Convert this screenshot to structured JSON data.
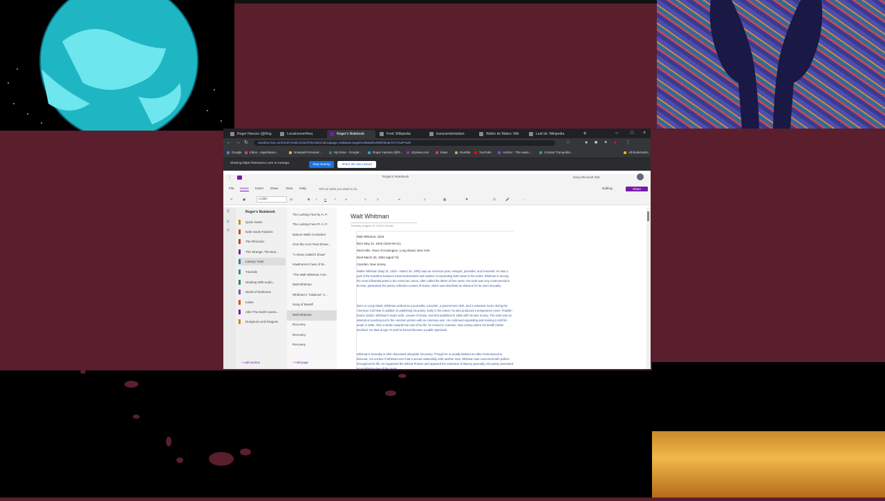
{
  "browser": {
    "tabs": [
      {
        "label": "Roger Hanson (@Rog"
      },
      {
        "label": "Localconvertfreq"
      },
      {
        "label": "Roger's Notebook"
      },
      {
        "label": "Fred: Wikipedia"
      },
      {
        "label": "transcendentalism"
      },
      {
        "label": "Walter de Mateo: Wik"
      },
      {
        "label": "Leaf de: Wikipedia"
      }
    ],
    "new_tab": "+",
    "url": "onedrive.live.com/redir?resid=DAE2F06A4E0C3E1&page=Edit&wd=target%28Walt%20Whitman%7C%2F%29",
    "bookmarks": [
      {
        "label": "Google",
        "color": "#4285f4"
      },
      {
        "label": "Inbox - rogerhanso...",
        "color": "#ea4335"
      },
      {
        "label": "Notepad Personal...",
        "color": "#f4b400"
      },
      {
        "label": "My Drive - Google...",
        "color": "#0f9d58"
      },
      {
        "label": "Roger Hanson (@R...",
        "color": "#1da1f2"
      },
      {
        "label": "cityview.com",
        "color": "#9c27b0"
      },
      {
        "label": "Kiwix",
        "color": "#e53935"
      },
      {
        "label": "Rumble",
        "color": "#85c742"
      },
      {
        "label": "YouTube",
        "color": "#ff0000"
      },
      {
        "label": "Anchor - The easie...",
        "color": "#8940fa"
      },
      {
        "label": "Contact Tranquilitо...",
        "color": "#34a853"
      },
      {
        "label": "All Bookmarks",
        "color": "#f4b400"
      }
    ],
    "share_notice": "Sharing https://streamco.com to meetgo.",
    "stop_sharing": "Stop sharing",
    "hide": "Share this tab instead"
  },
  "onenote": {
    "title": "Roger's Notebook",
    "user": "Easy Microsoft 365",
    "menu": [
      "File",
      "Home",
      "Insert",
      "Draw",
      "View",
      "Help"
    ],
    "selected_menu": "Home",
    "tell_me": "Tell me what you want to do",
    "editing": "Editing",
    "share": "Share",
    "font": "Calibri",
    "size": "11",
    "notebook": "Roger's Notebook",
    "sections": [
      {
        "label": "Quick Notes",
        "color": "#c28a1c"
      },
      {
        "label": "Dark Souls Fandom",
        "color": "#d04a0a"
      },
      {
        "label": "The Rhizomic",
        "color": "#c0392b"
      },
      {
        "label": "The Strange, The Bus...",
        "color": "#7719aa"
      },
      {
        "label": "Literary Voter",
        "color": "#2a7ab8"
      },
      {
        "label": "Tutorials",
        "color": "#16a085"
      },
      {
        "label": "Working With audio...",
        "color": "#2e8b3c"
      },
      {
        "label": "World of Darkness",
        "color": "#8e44ad"
      },
      {
        "label": "Kathe",
        "color": "#d35400"
      },
      {
        "label": "Alter The Earth Canne...",
        "color": "#7719aa"
      },
      {
        "label": "Dungeons and Dragons",
        "color": "#c28a1c"
      }
    ],
    "selected_section": "Literary Voter",
    "add_section": "+ Add section",
    "pages": [
      "The Lurking Fear by H. P.",
      "The Lurking Fear Pt. II, P.",
      "Nahum Wells Considers",
      "Give the Corn Past Showi...",
      "\"A Show Called's Show\"",
      "Hawthorne's hear of W...",
      "\"The Walt Whitman Acts...",
      "Walt Whitman",
      "Whitman's \"Calamus\" A...",
      "Song of Myself",
      "Walt Whitman",
      "Recovery",
      "Recovery",
      "Recovery"
    ],
    "selected_page": 10,
    "add_page": "+ Add page",
    "page_title": "Walt Whitman",
    "page_date": "Tuesday, August 29, 2023    9:34 AM",
    "note_lines": [
      "Walt Whitman: 1819",
      "Born May 31, 1819 (1819-05-31)",
      "West Hills, Town of Huntington, Long Island, New York",
      "Died March 26, 1892 (aged 72)",
      "Camden, New Jersey"
    ],
    "paragraphs": [
      "Walter Whitman (May 31, 1819 – March 26, 1892) was an American poet, essayist, journalist, and humanist. He was a part of the transition between transcendentalism and realism, incorporating both views in his works. Whitman is among the most influential poets in the American canon, often called the father of free verse. His work was very controversial in its time, particularly his poetry collection Leaves of Grass, which was described as obscene for its overt sexuality.",
      "Born on Long Island, Whitman worked as a journalist, a teacher, a government clerk, and a volunteer nurse during the American Civil War in addition to publishing his poetry. Early in his career, he also produced a temperance novel, Franklin Evans (1842). Whitman's major work, Leaves of Grass, was first published in 1855 with his own money. The work was an attempt at reaching out to the common person with an American epic. He continued expanding and revising it until his death in 1892. After a stroke towards the end of his life, he moved to Camden, New Jersey where his health further declined. He died at age 72 and his funeral became a public spectacle.",
      "Whitman's sexuality is often discussed alongside his poetry. Though he is usually labeled as either homosexual or bisexual, it is unclear if Whitman ever had a sexual relationship with another man. Whitman was concerned with politics throughout his life. He supported the Wilmot Proviso and opposed the extension of slavery generally. His poetry presented an egalitarian view of the races."
    ]
  }
}
